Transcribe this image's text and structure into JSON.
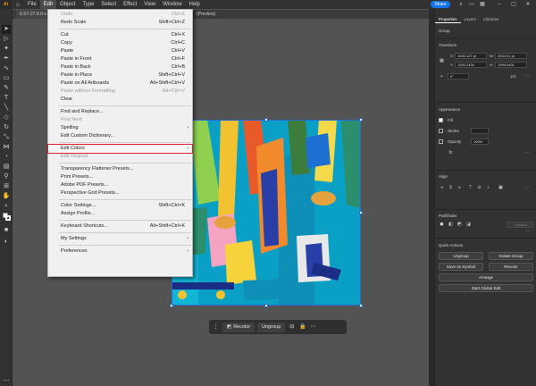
{
  "app": {
    "logo": "Ai"
  },
  "menubar": [
    "File",
    "Edit",
    "Object",
    "Type",
    "Select",
    "Effect",
    "View",
    "Window",
    "Help"
  ],
  "share_label": "Share",
  "tabs": [
    {
      "label": "ILST-27.9.0-x"
    },
    {
      "label": "(Preview)"
    }
  ],
  "edit_menu": [
    {
      "label": "Undo",
      "shortcut": "Ctrl+Z",
      "disabled": true
    },
    {
      "label": "Redo Scale",
      "shortcut": "Shift+Ctrl+Z"
    },
    {
      "sep": true
    },
    {
      "label": "Cut",
      "shortcut": "Ctrl+X"
    },
    {
      "label": "Copy",
      "shortcut": "Ctrl+C"
    },
    {
      "label": "Paste",
      "shortcut": "Ctrl+V"
    },
    {
      "label": "Paste in Front",
      "shortcut": "Ctrl+F"
    },
    {
      "label": "Paste in Back",
      "shortcut": "Ctrl+B"
    },
    {
      "label": "Paste in Place",
      "shortcut": "Shift+Ctrl+V"
    },
    {
      "label": "Paste on All Artboards",
      "shortcut": "Alt+Shift+Ctrl+V"
    },
    {
      "label": "Paste without Formatting",
      "shortcut": "Alt+Ctrl+V",
      "disabled": true
    },
    {
      "label": "Clear"
    },
    {
      "sep": true
    },
    {
      "label": "Find and Replace..."
    },
    {
      "label": "Find Next",
      "disabled": true
    },
    {
      "label": "Spelling",
      "submenu": true
    },
    {
      "label": "Edit Custom Dictionary..."
    },
    {
      "sep": true
    },
    {
      "label": "Edit Colors",
      "submenu": true,
      "highlighted": true
    },
    {
      "label": "Edit Original",
      "disabled": true
    },
    {
      "sep": true
    },
    {
      "label": "Transparency Flattener Presets..."
    },
    {
      "label": "Print Presets..."
    },
    {
      "label": "Adobe PDF Presets..."
    },
    {
      "label": "Perspective Grid Presets..."
    },
    {
      "sep": true
    },
    {
      "label": "Color Settings...",
      "shortcut": "Shift+Ctrl+K"
    },
    {
      "label": "Assign Profile..."
    },
    {
      "sep": true
    },
    {
      "label": "Keyboard Shortcuts...",
      "shortcut": "Alt+Shift+Ctrl+K"
    },
    {
      "sep": true
    },
    {
      "label": "My Settings",
      "submenu": true
    },
    {
      "sep": true
    },
    {
      "label": "Preferences",
      "submenu": true
    }
  ],
  "context_bar": {
    "recolor": "Recolor",
    "ungroup": "Ungroup"
  },
  "panel": {
    "tabs": [
      "Properties",
      "Layers",
      "Libraries"
    ],
    "group_label": "Group",
    "transform": {
      "title": "Transform",
      "x": "1000.127 pt",
      "y": "1000.2434",
      "w": "2004.01 pt",
      "h": "1999.0401",
      "angle": "0°",
      "ratio": "1/4"
    },
    "appearance": {
      "title": "Appearance",
      "fill": "Fill",
      "stroke": "Stroke",
      "opacity_label": "Opacity",
      "opacity_value": "100%"
    },
    "align_title": "Align",
    "pathfinder_title": "Pathfinder",
    "pathfinder_expand": "Expand",
    "quick_actions": {
      "title": "Quick Actions",
      "ungroup": "Ungroup",
      "isolate": "Isolate Group",
      "symbol": "Save as Symbol",
      "recolor": "Recolor",
      "arrange": "Arrange",
      "global_edit": "Start Global Edit"
    }
  },
  "colors": {
    "artboard_bg": "#0aa0c6",
    "accent": "#1473e6",
    "highlight": "#e0202e"
  }
}
